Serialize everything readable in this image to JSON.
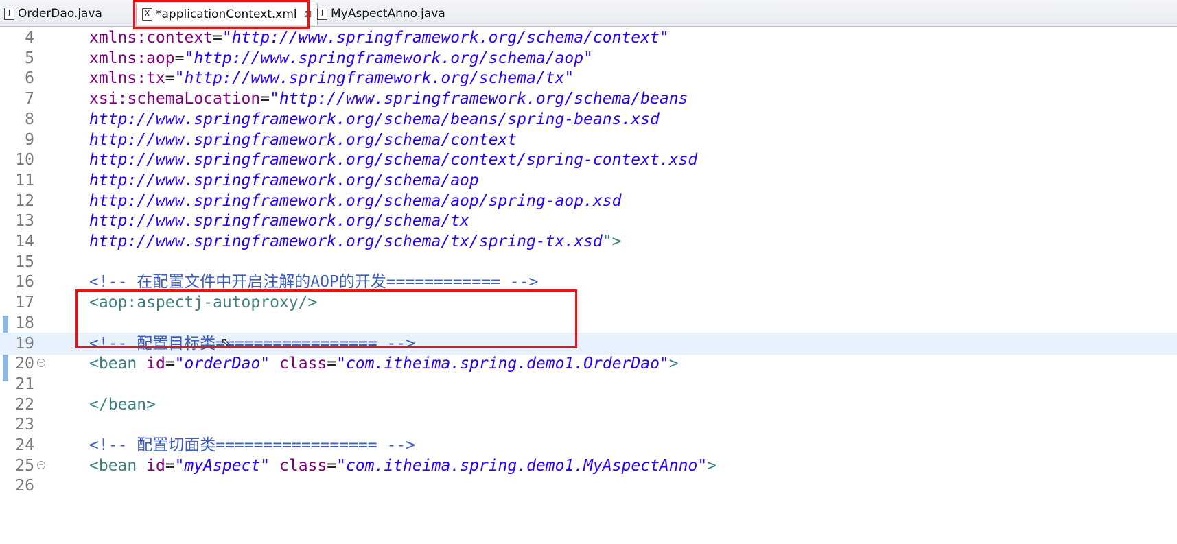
{
  "tabs": [
    {
      "label": "OrderDao.java",
      "icon": "java-file-icon",
      "glyph": "J"
    },
    {
      "label": "*applicationContext.xml",
      "icon": "xml-file-icon",
      "glyph": "X",
      "close": "⊠"
    },
    {
      "label": "MyAspectAnno.java",
      "icon": "java-file-icon",
      "glyph": "J"
    }
  ],
  "lines": [
    {
      "n": "4",
      "code": "xmlns:context=\"http://www.springframework.org/schema/context\""
    },
    {
      "n": "5",
      "code": "xmlns:aop=\"http://www.springframework.org/schema/aop\""
    },
    {
      "n": "6",
      "code": "xmlns:tx=\"http://www.springframework.org/schema/tx\""
    },
    {
      "n": "7",
      "code": "xsi:schemaLocation=\"http://www.springframework.org/schema/beans"
    },
    {
      "n": "8",
      "code": "http://www.springframework.org/schema/beans/spring-beans.xsd"
    },
    {
      "n": "9",
      "code": "http://www.springframework.org/schema/context"
    },
    {
      "n": "10",
      "code": "http://www.springframework.org/schema/context/spring-context.xsd"
    },
    {
      "n": "11",
      "code": "http://www.springframework.org/schema/aop"
    },
    {
      "n": "12",
      "code": "http://www.springframework.org/schema/aop/spring-aop.xsd"
    },
    {
      "n": "13",
      "code": "http://www.springframework.org/schema/tx"
    },
    {
      "n": "14",
      "code": "http://www.springframework.org/schema/tx/spring-tx.xsd\">"
    },
    {
      "n": "15",
      "code": ""
    },
    {
      "n": "16",
      "code": "<!-- 在配置文件中开启注解的AOP的开发============ -->"
    },
    {
      "n": "17",
      "code": "<aop:aspectj-autoproxy/>"
    },
    {
      "n": "18",
      "code": ""
    },
    {
      "n": "19",
      "code": "<!-- 配置目标类================= -->"
    },
    {
      "n": "20",
      "code": "<bean id=\"orderDao\" class=\"com.itheima.spring.demo1.OrderDao\">"
    },
    {
      "n": "21",
      "code": ""
    },
    {
      "n": "22",
      "code": "</bean>"
    },
    {
      "n": "23",
      "code": ""
    },
    {
      "n": "24",
      "code": "<!-- 配置切面类================= -->"
    },
    {
      "n": "25",
      "code": "<bean id=\"myAspect\" class=\"com.itheima.spring.demo1.MyAspectAnno\">"
    },
    {
      "n": "26",
      "code": ""
    }
  ]
}
